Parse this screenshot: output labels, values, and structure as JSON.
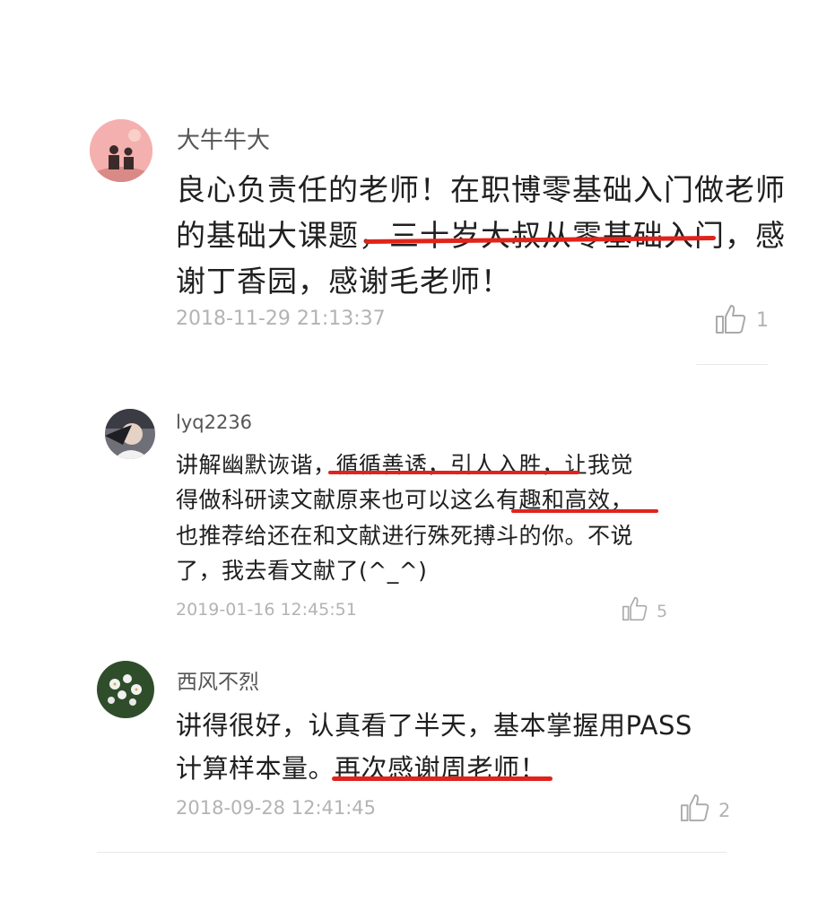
{
  "comments": [
    {
      "username": "大牛牛大",
      "lines": [
        "良心负责任的老师！在职博零基础入门做老师",
        "的基础大课题，三十岁大叔从零基础入门，感",
        "谢丁香园，感谢毛老师！"
      ],
      "timestamp": "2018-11-29 21:13:37",
      "likes": "1",
      "avatar_icon": "couple-silhouette-icon"
    },
    {
      "username": "lyq2236",
      "lines": [
        "讲解幽默诙谐，循循善诱，引人入胜，让我觉",
        "得做科研读文献原来也可以这么有趣和高效，",
        "也推荐给还在和文献进行殊死搏斗的你。不说",
        "了，我去看文献了(^_^)"
      ],
      "timestamp": "2019-01-16 12:45:51",
      "likes": "5",
      "avatar_icon": "portrait-photo-icon"
    },
    {
      "username": "西风不烈",
      "lines": [
        "讲得很好，认真看了半天，基本掌握用PASS",
        "计算样本量。再次感谢周老师！"
      ],
      "timestamp": "2018-09-28 12:41:45",
      "likes": "2",
      "avatar_icon": "white-flower-icon"
    }
  ],
  "colors": {
    "highlight_underline": "#e0241b",
    "meta_text": "#b3b3b3",
    "body_text": "#1f1f1f"
  }
}
